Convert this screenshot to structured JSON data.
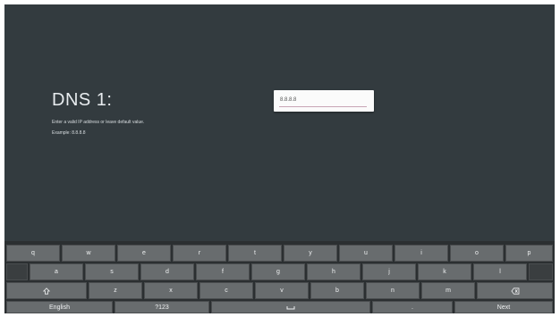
{
  "dialog": {
    "title": "DNS 1:",
    "description": "Enter a valid IP address or leave default value.",
    "example": "Example: 8.8.8.8",
    "input_value": "8.8.8.8"
  },
  "keyboard": {
    "row1": [
      "q",
      "w",
      "e",
      "r",
      "t",
      "y",
      "u",
      "i",
      "o",
      "p"
    ],
    "row2": [
      "a",
      "s",
      "d",
      "f",
      "g",
      "h",
      "j",
      "k",
      "l"
    ],
    "row3_letters": [
      "z",
      "x",
      "c",
      "v",
      "b",
      "n",
      "m"
    ],
    "language_label": "English",
    "symbols_label": "?123",
    "period_label": ".",
    "next_label": "Next"
  },
  "icons": {
    "shift": "shift-icon",
    "delete": "backspace-icon",
    "space": "space-icon"
  }
}
